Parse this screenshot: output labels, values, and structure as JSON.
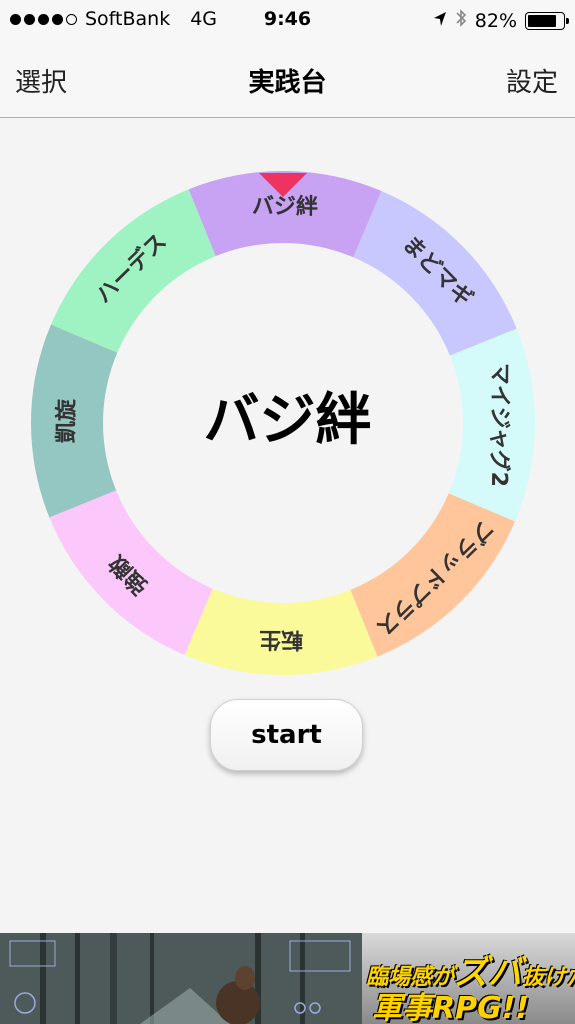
{
  "status_bar": {
    "carrier": "SoftBank",
    "network": "4G",
    "time": "9:46",
    "battery_percent": "82%",
    "battery_level": 0.82,
    "signal_bars": 4,
    "signal_total": 5
  },
  "nav": {
    "left_label": "選択",
    "title": "実践台",
    "right_label": "設定"
  },
  "roulette": {
    "selected": "バジ絆",
    "pointer_color": "#ee3360",
    "segments": [
      {
        "label": "バジ絆",
        "color": "#c8a2f3"
      },
      {
        "label": "まどマギ",
        "color": "#c8c8ff"
      },
      {
        "label": "マイジャグ2",
        "color": "#d4fbfa"
      },
      {
        "label": "ブラッドプラス",
        "color": "#ffc69c"
      },
      {
        "label": "転生",
        "color": "#fbfa9a"
      },
      {
        "label": "強敵",
        "color": "#fcc8fc"
      },
      {
        "label": "凱旋",
        "color": "#94c6c2"
      },
      {
        "label": "ハーデス",
        "color": "#9ff3c2"
      }
    ]
  },
  "start_button": {
    "label": "start"
  },
  "ad": {
    "line1_a": "臨場感が",
    "line1_b": "ズバ",
    "line1_c": "抜けた",
    "line2": "軍事RPG!!"
  }
}
